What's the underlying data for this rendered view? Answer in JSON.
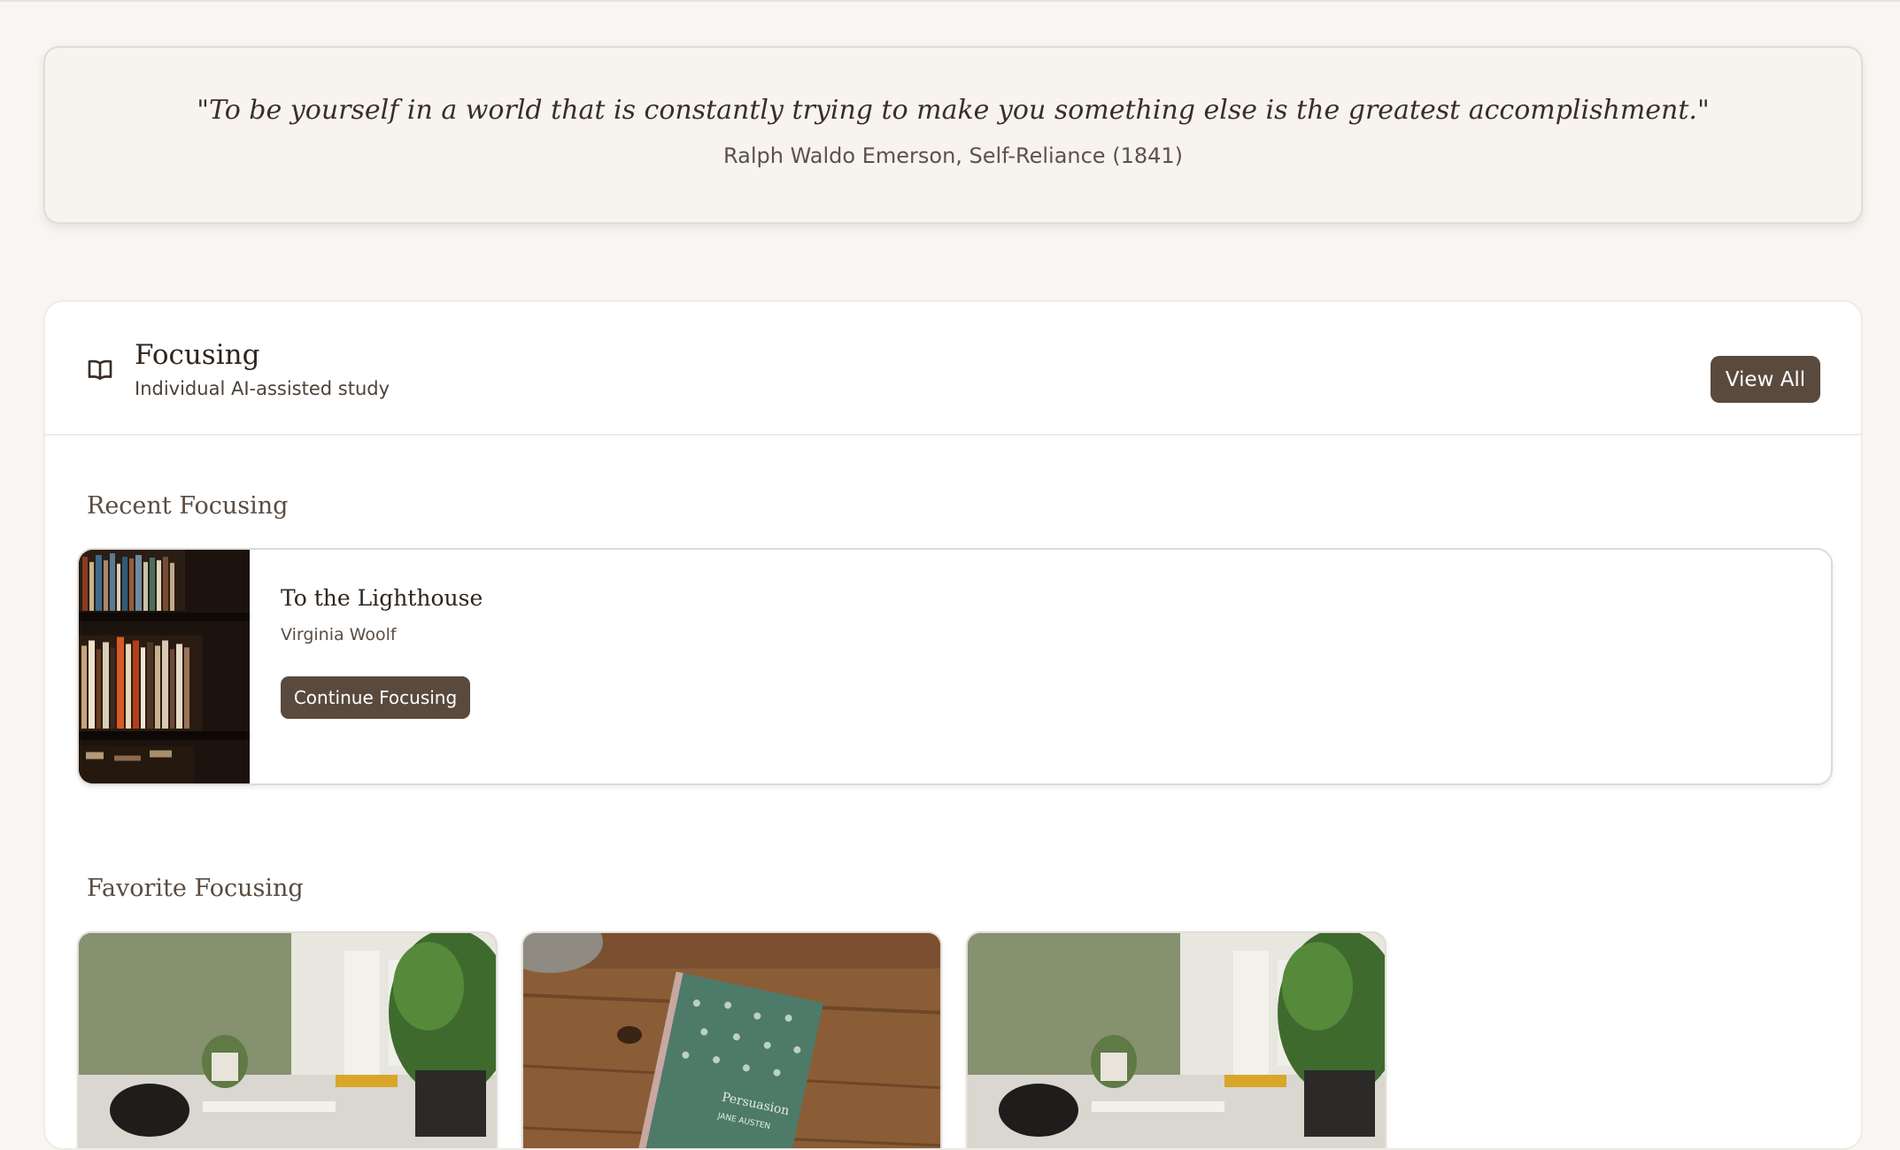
{
  "quote": {
    "text": "\"To be yourself in a world that is constantly trying to make you something else is the greatest accomplishment.\"",
    "source": "Ralph Waldo Emerson, Self-Reliance (1841)"
  },
  "section": {
    "title": "Focusing",
    "subtitle": "Individual AI-assisted study",
    "view_all_label": "View All",
    "icon": "open-book-icon"
  },
  "recent": {
    "heading": "Recent Focusing",
    "items": [
      {
        "title": "To the Lighthouse",
        "author": "Virginia Woolf",
        "button_label": "Continue Focusing"
      }
    ]
  },
  "favorites": {
    "heading": "Favorite Focusing",
    "items": [
      {
        "image": "desk-with-plant-photo"
      },
      {
        "image": "persuasion-book-photo",
        "book_title": "Persuasion",
        "book_author": "JANE AUSTEN"
      },
      {
        "image": "desk-with-plant-photo"
      }
    ]
  },
  "colors": {
    "background": "#f8f6f2",
    "accent_button": "#5a4a3e"
  }
}
